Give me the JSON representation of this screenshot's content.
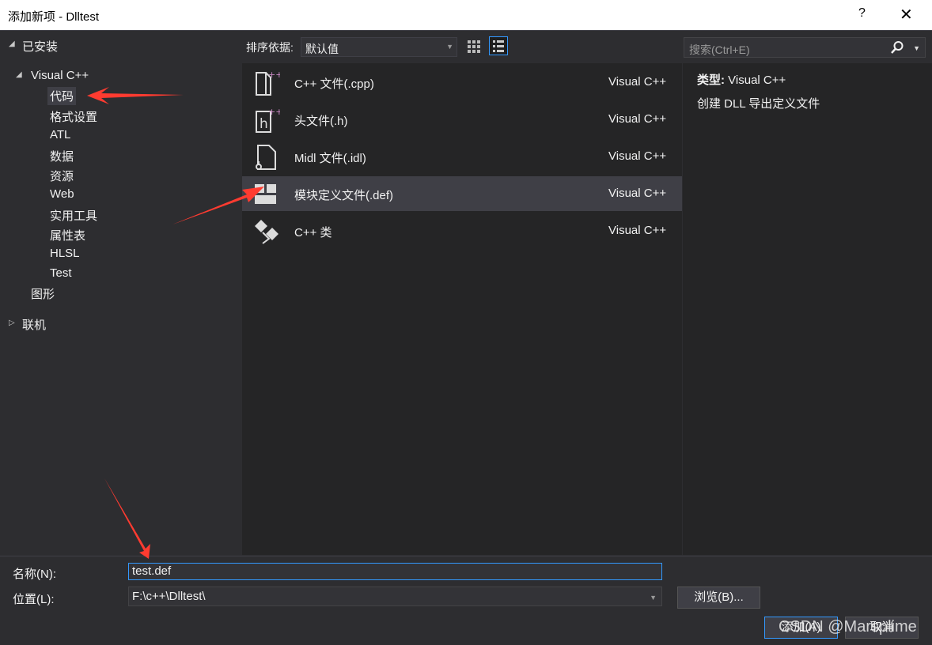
{
  "window": {
    "title": "添加新项 - Dlltest",
    "help": "?",
    "close": "✕"
  },
  "tree": {
    "installed": "已安装",
    "visual_cpp": "Visual C++",
    "children": [
      "代码",
      "格式设置",
      "ATL",
      "数据",
      "资源",
      "Web",
      "实用工具",
      "属性表",
      "HLSL",
      "Test"
    ],
    "graphics": "图形",
    "online": "联机"
  },
  "toolbar": {
    "sort_label": "排序依据:",
    "sort_value": "默认值",
    "search_placeholder": "搜索(Ctrl+E)"
  },
  "items": [
    {
      "name": "C++ 文件(.cpp)",
      "lang": "Visual C++",
      "icon": "cpp-file-icon"
    },
    {
      "name": "头文件(.h)",
      "lang": "Visual C++",
      "icon": "header-file-icon"
    },
    {
      "name": "Midl 文件(.idl)",
      "lang": "Visual C++",
      "icon": "midl-file-icon"
    },
    {
      "name": "模块定义文件(.def)",
      "lang": "Visual C++",
      "icon": "module-def-icon",
      "selected": true
    },
    {
      "name": "C++ 类",
      "lang": "Visual C++",
      "icon": "cpp-class-icon"
    }
  ],
  "details": {
    "type_label": "类型:",
    "type_value": "Visual C++",
    "description": "创建 DLL 导出定义文件"
  },
  "form": {
    "name_label": "名称(N):",
    "name_value": "test.def",
    "location_label": "位置(L):",
    "location_value": "F:\\c++\\Dlltest\\",
    "browse": "浏览(B)...",
    "add": "添加(A)",
    "cancel": "取消"
  },
  "watermark": "CSDN @Marsplime",
  "colors": {
    "accent": "#3399ff",
    "annotation_arrow": "#ff3b30",
    "background": "#2d2d30"
  }
}
